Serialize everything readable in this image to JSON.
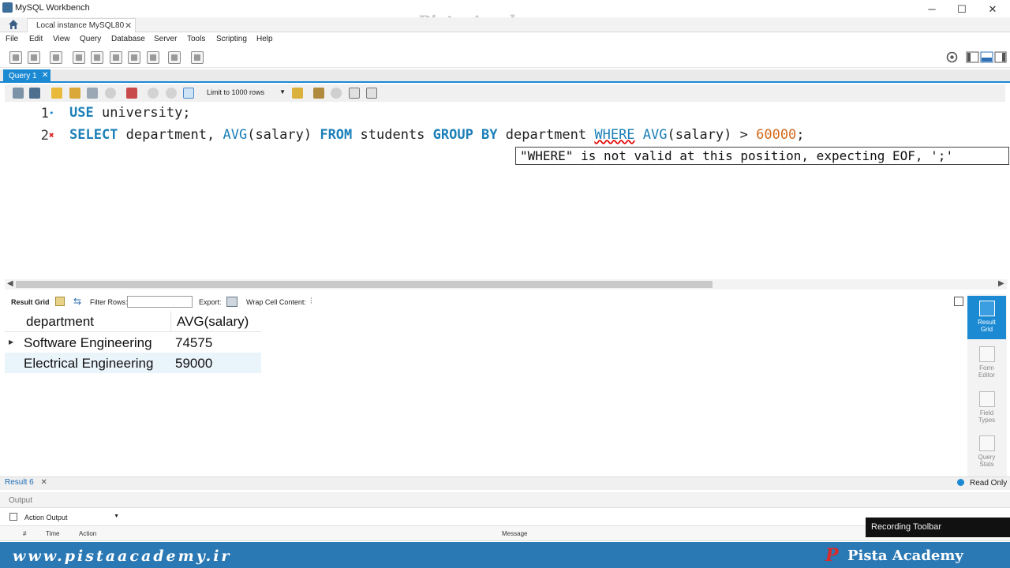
{
  "window": {
    "title": "MySQL Workbench",
    "watermark": "Pista Academy",
    "minimize": "─",
    "maximize": "☐",
    "close": "✕"
  },
  "connection_tab": {
    "label": "Local instance MySQL80",
    "close": "✕"
  },
  "menu": [
    "File",
    "Edit",
    "View",
    "Query",
    "Database",
    "Server",
    "Tools",
    "Scripting",
    "Help"
  ],
  "query_tab": {
    "label": "Query 1",
    "close": "✕"
  },
  "editor_toolbar": {
    "limit_label": "Limit to 1000 rows"
  },
  "editor": {
    "lines": [
      {
        "number": "1",
        "marker": "•"
      },
      {
        "number": "2",
        "marker": "✖"
      }
    ],
    "line1": {
      "kw_use": "USE",
      "rest": " university;"
    },
    "line2": {
      "kw_select": "SELECT",
      "t1": " department, ",
      "fn_avg1": "AVG",
      "t2": "(salary) ",
      "kw_from": "FROM",
      "t3": " students ",
      "kw_group": "GROUP BY",
      "t4": " department ",
      "kw_where": "WHERE",
      "t5": " ",
      "fn_avg2": "AVG",
      "t6": "(salary) > ",
      "num": "60000",
      "t7": ";"
    },
    "error_tooltip": "\"WHERE\" is not valid at this position, expecting EOF, ';'"
  },
  "result_toolbar": {
    "result_grid": "Result Grid",
    "filter_rows": "Filter Rows:",
    "filter_value": "",
    "export": "Export:",
    "wrap": "Wrap Cell Content:"
  },
  "result_grid": {
    "columns": [
      "department",
      "AVG(salary)"
    ],
    "rows": [
      [
        "Software Engineering",
        "74575"
      ],
      [
        "Electrical Engineering",
        "59000"
      ]
    ]
  },
  "sidebar": [
    {
      "label": "Result\nGrid",
      "active": true
    },
    {
      "label": "Form\nEditor",
      "active": false
    },
    {
      "label": "Field\nTypes",
      "active": false
    },
    {
      "label": "Query\nStats",
      "active": false
    }
  ],
  "result_tab": {
    "label": "Result 6",
    "close": "✕",
    "status": "Read Only"
  },
  "output": {
    "title": "Output",
    "selector": "Action Output",
    "columns": [
      "#",
      "Time",
      "Action",
      "Message"
    ]
  },
  "overlay": {
    "recording_toolbar": "Recording Toolbar"
  },
  "footer": {
    "site": "www.pistaacademy.ir",
    "logo": "P",
    "brand": "Pista Academy"
  },
  "colors": {
    "accent": "#1c8ad3",
    "keyword": "#1b7fb8",
    "number": "#d2691e",
    "footer": "#2a78b4",
    "error": "#e00000"
  }
}
